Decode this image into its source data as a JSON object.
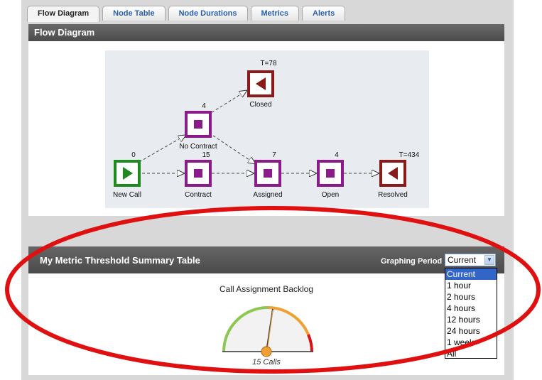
{
  "tabs": [
    {
      "label": "Flow Diagram",
      "active": true
    },
    {
      "label": "Node Table",
      "active": false
    },
    {
      "label": "Node Durations",
      "active": false
    },
    {
      "label": "Metrics",
      "active": false
    },
    {
      "label": "Alerts",
      "active": false
    }
  ],
  "flow_panel": {
    "title": "Flow Diagram",
    "nodes": [
      {
        "id": "new-call",
        "label": "New Call",
        "count": "0",
        "type": "start",
        "color": "#1f8a1f"
      },
      {
        "id": "contract",
        "label": "Contract",
        "count": "15",
        "type": "state",
        "color": "#8b1a8b"
      },
      {
        "id": "no-contract",
        "label": "No Contract",
        "count": "4",
        "type": "state",
        "color": "#8b1a8b"
      },
      {
        "id": "assigned",
        "label": "Assigned",
        "count": "7",
        "type": "state",
        "color": "#8b1a8b"
      },
      {
        "id": "open",
        "label": "Open",
        "count": "4",
        "type": "state",
        "color": "#8b1a8b"
      },
      {
        "id": "closed",
        "label": "Closed",
        "count": "T=78",
        "type": "end",
        "color": "#8b1a1a"
      },
      {
        "id": "resolved",
        "label": "Resolved",
        "count": "T=434",
        "type": "end",
        "color": "#8b1a1a"
      }
    ]
  },
  "metric_panel": {
    "title": "My Metric Threshold Summary Table",
    "graphing_period_label": "Graphing Period",
    "selected_period": "Current",
    "period_options": [
      "Current",
      "1 hour",
      "2 hours",
      "4 hours",
      "12 hours",
      "24 hours",
      "1 week",
      "All"
    ],
    "gauge": {
      "title": "Call Assignment Backlog",
      "value_text": "15 Calls",
      "zones": {
        "green": "#8cc850",
        "orange": "#f0a030",
        "red": "#dd1111"
      }
    }
  },
  "annotation": {
    "color": "#e01010"
  }
}
